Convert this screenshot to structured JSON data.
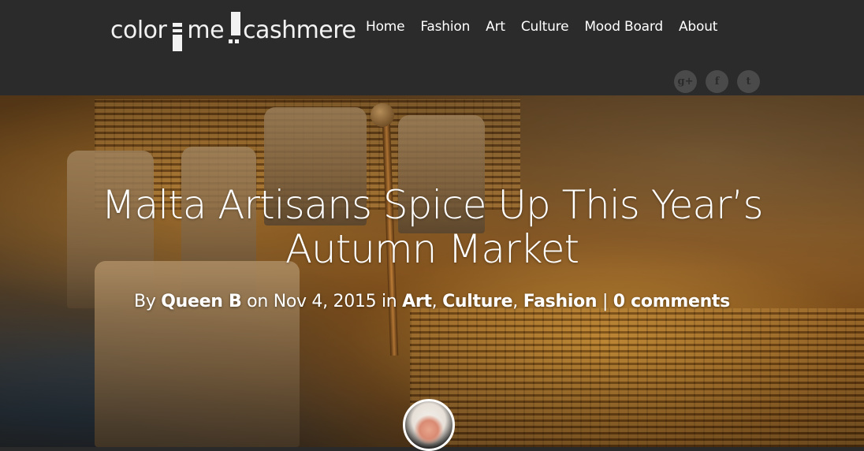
{
  "site": {
    "logo": {
      "part1": "color",
      "part2": "me",
      "part3": "cashmere"
    }
  },
  "nav": {
    "items": [
      {
        "label": "Home"
      },
      {
        "label": "Fashion"
      },
      {
        "label": "Art"
      },
      {
        "label": "Culture"
      },
      {
        "label": "Mood Board"
      },
      {
        "label": "About"
      }
    ]
  },
  "social": {
    "icons": [
      {
        "name": "google-plus-icon",
        "glyph": "g+"
      },
      {
        "name": "facebook-icon",
        "glyph": "f"
      },
      {
        "name": "twitter-icon",
        "glyph": "t"
      }
    ]
  },
  "post": {
    "title_line1": "Malta Artisans Spice Up This Year’s",
    "title_line2": "Autumn Market",
    "meta": {
      "by": "By",
      "author": "Queen B",
      "on": "on",
      "date": "Nov 4, 2015",
      "in": "in",
      "categories": [
        "Art",
        "Culture",
        "Fashion"
      ],
      "comma": ",",
      "separator": "|",
      "comments": "0 comments"
    }
  },
  "colors": {
    "header_bg": "#2b2b2b",
    "text": "#ffffff",
    "social_bg": "#4a4a4a"
  }
}
